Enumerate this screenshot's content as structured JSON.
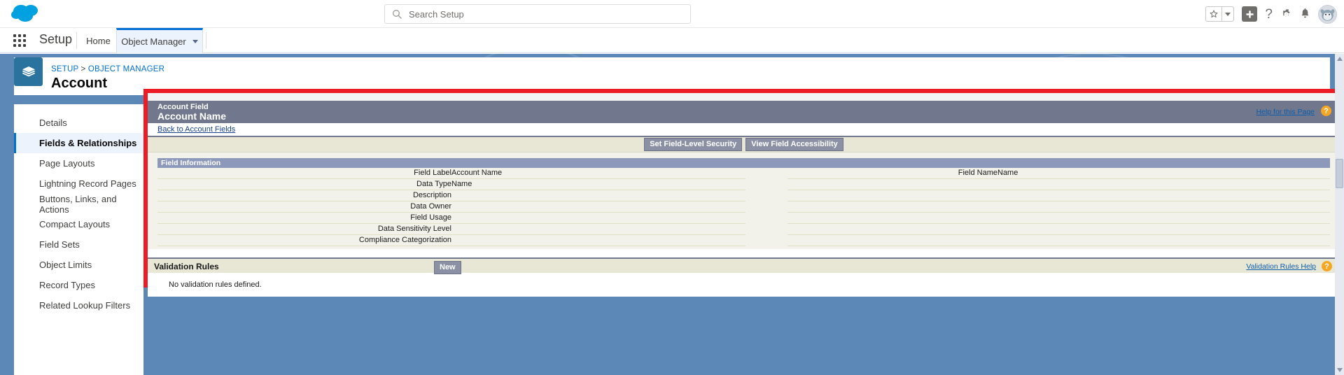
{
  "header": {
    "logo_icon": "salesforce-cloud-logo",
    "search": {
      "placeholder": "Search Setup",
      "value": "",
      "icon": "search-icon"
    },
    "icons": {
      "favorites": "star-icon",
      "favorites_caret": "chevron-down-icon",
      "add": "plus-icon",
      "help": "?",
      "settings": "gear-icon",
      "notifications": "bell-icon",
      "avatar": "user-avatar-icon"
    }
  },
  "setup_nav": {
    "app_launcher_icon": "waffle-grid-icon",
    "title": "Setup",
    "tabs": [
      {
        "label": "Home",
        "active": false,
        "has_caret": false
      },
      {
        "label": "Object Manager",
        "active": true,
        "has_caret": true
      }
    ]
  },
  "record_header": {
    "object_icon": "layers-stack-icon",
    "breadcrumb": {
      "root": "SETUP",
      "separator": ">",
      "current": "OBJECT MANAGER"
    },
    "title": "Account"
  },
  "sidebar": {
    "items": [
      {
        "label": "Details",
        "active": false
      },
      {
        "label": "Fields & Relationships",
        "active": true
      },
      {
        "label": "Page Layouts",
        "active": false
      },
      {
        "label": "Lightning Record Pages",
        "active": false
      },
      {
        "label": "Buttons, Links, and Actions",
        "active": false
      },
      {
        "label": "Compact Layouts",
        "active": false
      },
      {
        "label": "Field Sets",
        "active": false
      },
      {
        "label": "Object Limits",
        "active": false
      },
      {
        "label": "Record Types",
        "active": false
      },
      {
        "label": "Related Lookup Filters",
        "active": false
      }
    ]
  },
  "highlight": {
    "color": "#ed1c24"
  },
  "detail_panel": {
    "eyebrow": "Account Field",
    "title": "Account Name",
    "help_link": "Help for this Page",
    "help_badge": "?",
    "back_link": "Back to Account Fields",
    "buttons": [
      {
        "label": "Set Field-Level Security"
      },
      {
        "label": "View Field Accessibility"
      }
    ],
    "section_title": "Field Information",
    "rows": [
      {
        "label": "Field Label",
        "value": "Account Name",
        "label2": "Field Name",
        "value2": "Name"
      },
      {
        "label": "Data Type",
        "value": "Name",
        "label2": "",
        "value2": ""
      },
      {
        "label": "Description",
        "value": "",
        "label2": "",
        "value2": ""
      },
      {
        "label": "Data Owner",
        "value": "",
        "label2": "",
        "value2": ""
      },
      {
        "label": "Field Usage",
        "value": "",
        "label2": "",
        "value2": ""
      },
      {
        "label": "Data Sensitivity Level",
        "value": "",
        "label2": "",
        "value2": ""
      },
      {
        "label": "Compliance Categorization",
        "value": "",
        "label2": "",
        "value2": ""
      }
    ]
  },
  "validation_rules": {
    "title": "Validation Rules",
    "new_button": "New",
    "help_link": "Validation Rules Help",
    "help_badge": "?",
    "empty_message": "No validation rules defined."
  }
}
